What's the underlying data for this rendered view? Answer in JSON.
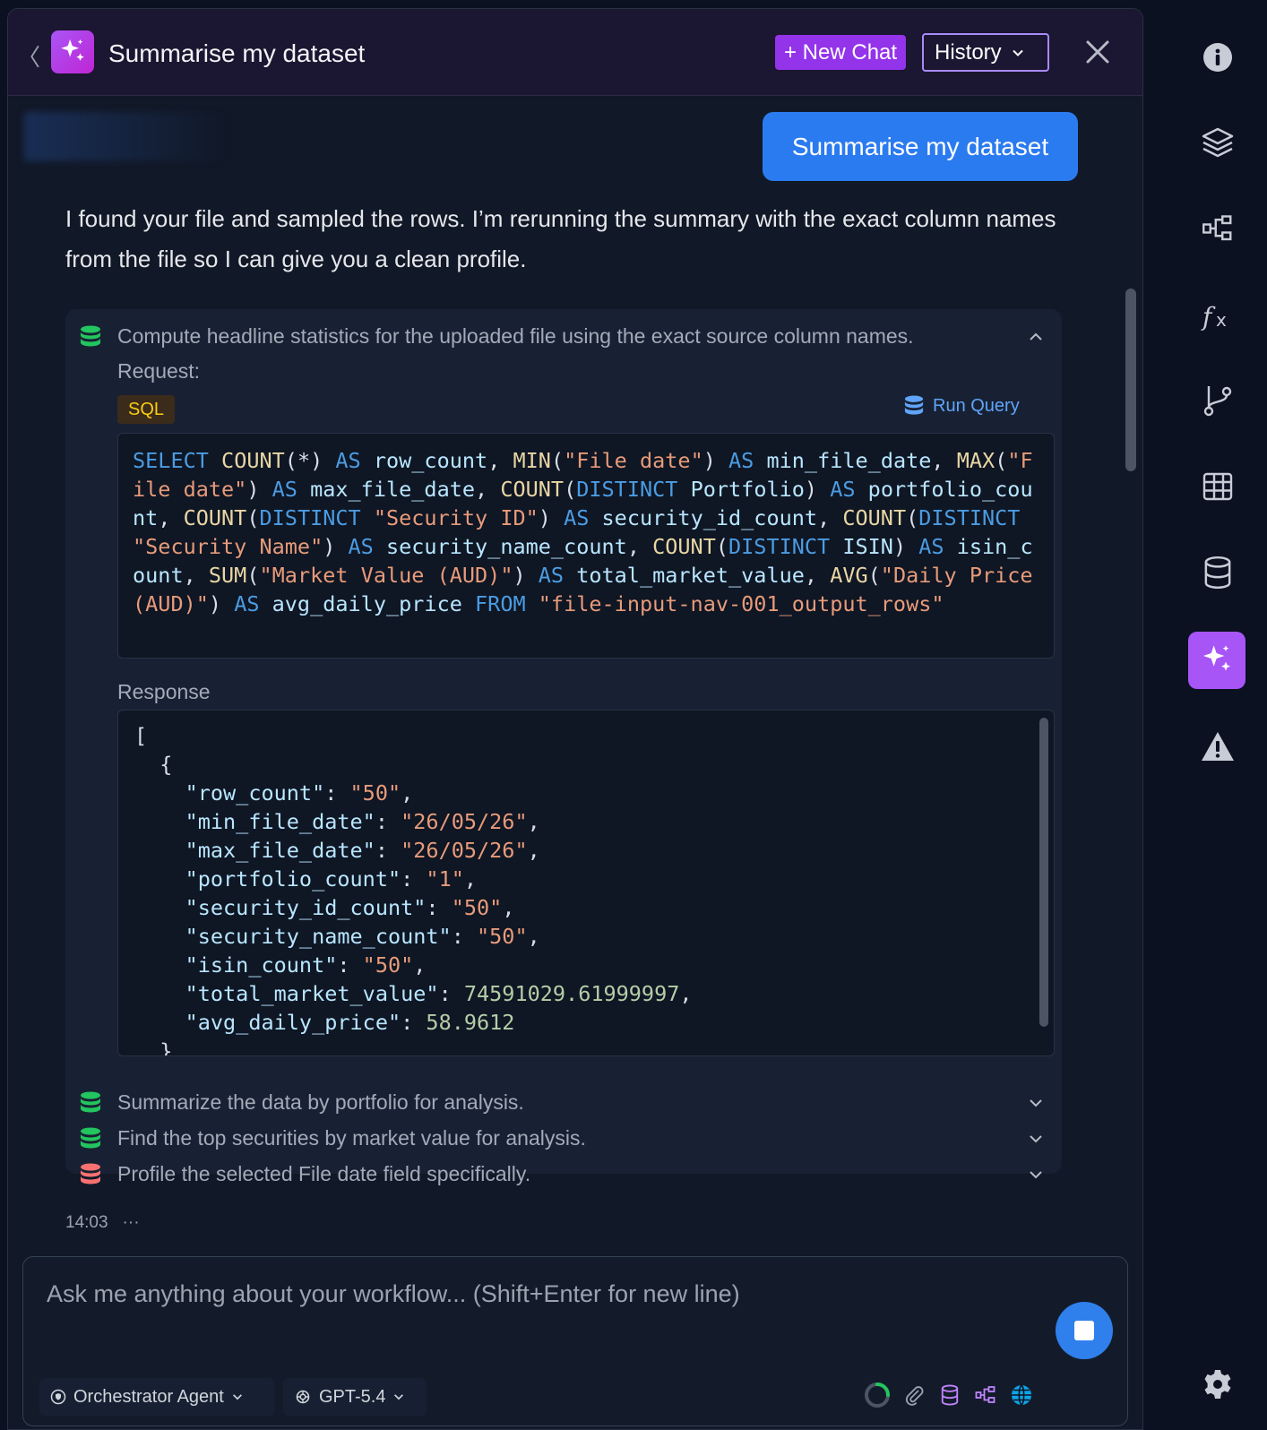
{
  "header": {
    "title": "Summarise my dataset",
    "new_chat_label": "+ New Chat",
    "history_label": "History"
  },
  "chat": {
    "user_message": "Summarise my dataset",
    "assistant_message": "I found your file and sampled the rows. I’m rerunning the summary with the exact column names from the file so I can give you a clean profile.",
    "tool_call": {
      "description": "Compute headline statistics for the uploaded file using the exact source column names.",
      "request_label": "Request:",
      "language_badge": "SQL",
      "run_query_label": "Run Query",
      "response_label": "Response"
    },
    "sub_tasks": [
      {
        "label": "Summarize the data by portfolio for analysis.",
        "status": "success"
      },
      {
        "label": "Find the top securities by market value for analysis.",
        "status": "success"
      },
      {
        "label": "Profile the selected File date field specifically.",
        "status": "error"
      }
    ],
    "timestamp": "14:03",
    "more": "···"
  },
  "input": {
    "placeholder": "Ask me anything about your workflow... (Shift+Enter for new line)",
    "agent_label": "Orchestrator Agent",
    "model_label": "GPT-5.4"
  },
  "colors": {
    "accent_purple": "#a855f7",
    "user_bubble": "#2b7bf0",
    "success_green": "#22c55e",
    "error_red": "#f87171"
  },
  "icons": {
    "rail": [
      "info-icon",
      "layers-icon",
      "workflow-icon",
      "function-icon",
      "branch-icon",
      "table-icon",
      "database-icon",
      "sparkles-icon",
      "warning-icon",
      "gear-icon"
    ],
    "input_tools": [
      "loading-spinner-icon",
      "paperclip-icon",
      "database-icon",
      "workflow-icon",
      "globe-icon"
    ]
  }
}
